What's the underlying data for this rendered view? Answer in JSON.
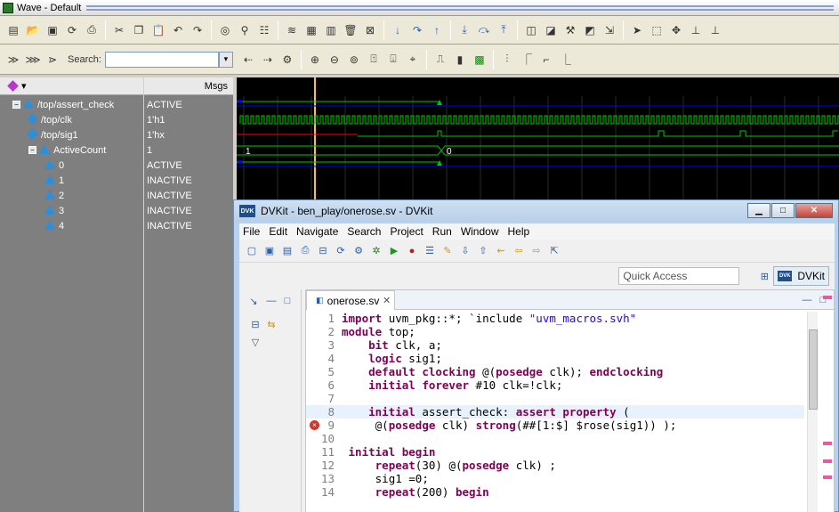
{
  "wave": {
    "title": "Wave - Default",
    "search_label": "Search:",
    "msgs_header": "Msgs",
    "signals": [
      {
        "label": "/top/assert_check",
        "value": "ACTIVE",
        "indent": 0,
        "icon": "triangle-icon",
        "expand": "−"
      },
      {
        "label": "/top/clk",
        "value": "1'h1",
        "indent": 1,
        "icon": "diamond-icon"
      },
      {
        "label": "/top/sig1",
        "value": "1'hx",
        "indent": 1,
        "icon": "diamond-icon"
      },
      {
        "label": "ActiveCount",
        "value": "1",
        "indent": 1,
        "icon": "triangle-icon",
        "expand": "−"
      },
      {
        "label": "0",
        "value": "ACTIVE",
        "indent": 2,
        "icon": "triangle-icon"
      },
      {
        "label": "1",
        "value": "INACTIVE",
        "indent": 2,
        "icon": "triangle-icon"
      },
      {
        "label": "2",
        "value": "INACTIVE",
        "indent": 2,
        "icon": "triangle-icon"
      },
      {
        "label": "3",
        "value": "INACTIVE",
        "indent": 2,
        "icon": "triangle-icon"
      },
      {
        "label": "4",
        "value": "INACTIVE",
        "indent": 2,
        "icon": "triangle-icon"
      }
    ],
    "bus_labels": {
      "before": "1",
      "after": "0"
    },
    "colors": {
      "signal": "#00c800",
      "cursor": "#ffc800",
      "x_state": "#ff0000",
      "marker": "#0000ff"
    }
  },
  "dvkit": {
    "title": "DVKit - ben_play/onerose.sv - DVKit",
    "logo": "DVK",
    "menu": [
      "File",
      "Edit",
      "Navigate",
      "Search",
      "Project",
      "Run",
      "Window",
      "Help"
    ],
    "quick_access": "Quick Access",
    "perspective": "DVKit",
    "editor_tab": "onerose.sv",
    "code_lines": [
      {
        "n": "1",
        "text": "import uvm_pkg::*; `include \"uvm_macros.svh\""
      },
      {
        "n": "2",
        "text": "module top;"
      },
      {
        "n": "3",
        "text": "    bit clk, a;"
      },
      {
        "n": "4",
        "text": "    logic sig1;"
      },
      {
        "n": "5",
        "text": "    default clocking @(posedge clk); endclocking"
      },
      {
        "n": "6",
        "text": "    initial forever #10 clk=!clk;"
      },
      {
        "n": "7",
        "text": ""
      },
      {
        "n": "8",
        "text": "    initial assert_check: assert property ("
      },
      {
        "n": "9",
        "text": "     @(posedge clk) strong(##[1:$] $rose(sig1)) );"
      },
      {
        "n": "10",
        "text": ""
      },
      {
        "n": "11",
        "text": " initial begin"
      },
      {
        "n": "12",
        "text": "     repeat(30) @(posedge clk) ;"
      },
      {
        "n": "13",
        "text": "     sig1 =0;"
      },
      {
        "n": "14",
        "text": "     repeat(200) begin"
      }
    ]
  }
}
